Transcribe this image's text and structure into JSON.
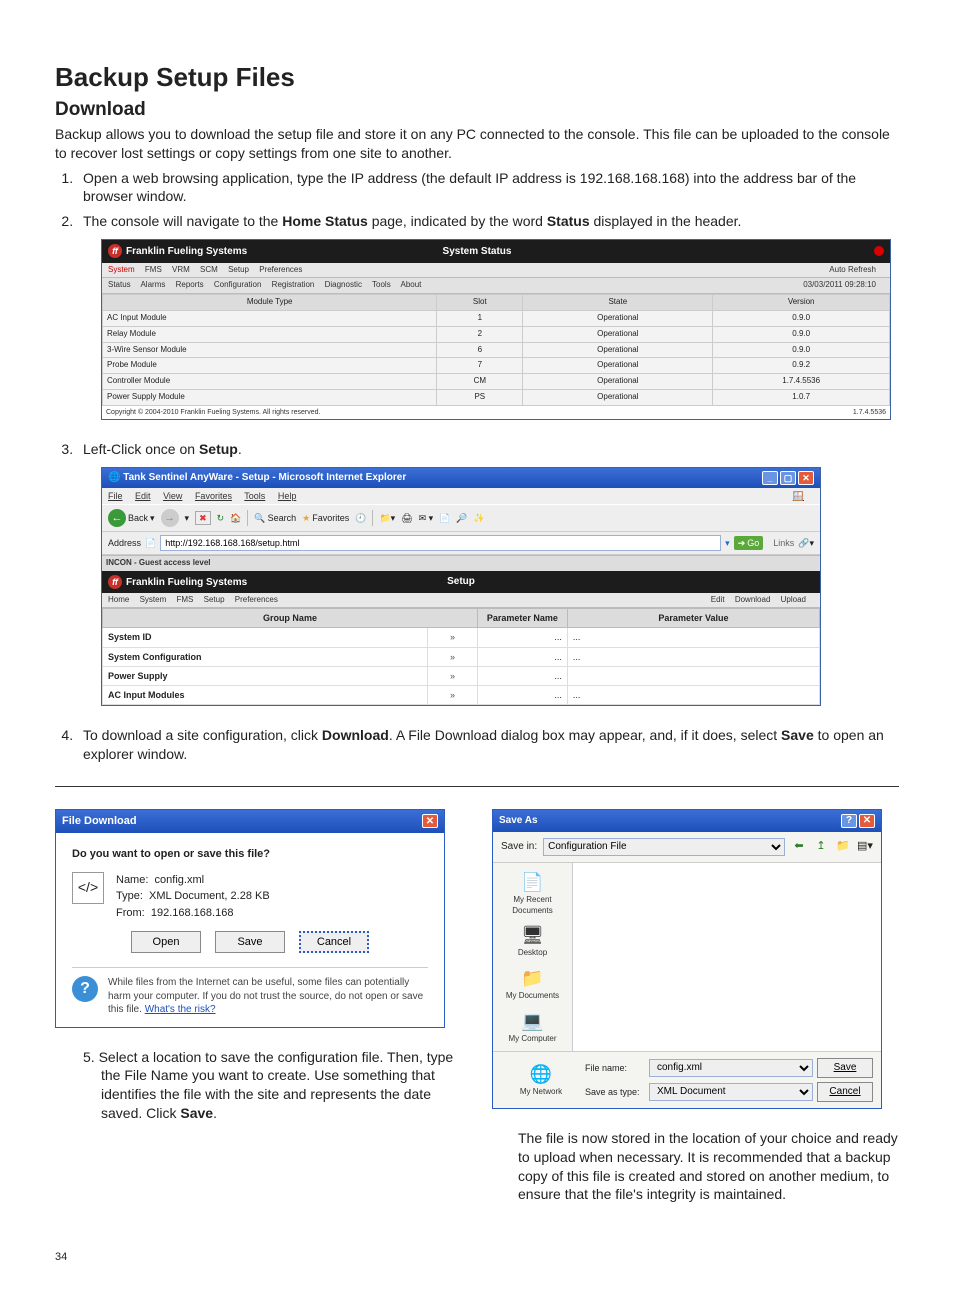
{
  "title": "Backup Setup Files",
  "sub": "Download",
  "intro": "Backup allows you to download the setup file and store it on any PC connected to the console. This file can be uploaded to the console to recover lost settings or copy settings from one site to another.",
  "step1a": "Open a web browsing application, type the IP address (the default IP address is 192.168.168.168) into the address bar of the browser window.",
  "step2a": "The console will navigate to the ",
  "step2b": "Home Status",
  "step2c": " page, indicated by the word ",
  "step2d": "Status",
  "step2e": " displayed in the header.",
  "step3a": "Left-Click once on ",
  "step3b": "Setup",
  "step3c": ".",
  "step4a": "To download a site configuration, click ",
  "step4b": "Download",
  "step4c": ". A File Download dialog box may appear, and, if it does, select ",
  "step4d": "Save",
  "step4e": " to open an explorer window.",
  "step5a": "5.   Select a location to save the configuration file. Then, type the File Name you want to create. Use something that identifies the file with the site and represents the date saved. Click ",
  "step5b": "Save",
  "step5c": ".",
  "finalNote": "The file is now stored in the location of your choice and ready to upload when necessary. It is recommended that a backup copy of this file is created and stored on another medium, to ensure that the file's integrity is maintained.",
  "fig1": {
    "brand": "Franklin Fueling Systems",
    "hdrCenter": "System Status",
    "autoRefresh": "Auto Refresh",
    "timestamp": "03/03/2011 09:28:10",
    "tabsL": [
      "System",
      "FMS",
      "VRM",
      "SCM",
      "Setup",
      "Preferences"
    ],
    "subtabs": [
      "Status",
      "Alarms",
      "Reports",
      "Configuration",
      "Registration",
      "Diagnostic",
      "Tools",
      "About"
    ],
    "cols": [
      "Module Type",
      "Slot",
      "State",
      "Version"
    ],
    "rows": [
      [
        "AC Input Module",
        "1",
        "Operational",
        "0.9.0"
      ],
      [
        "Relay Module",
        "2",
        "Operational",
        "0.9.0"
      ],
      [
        "3-Wire Sensor Module",
        "6",
        "Operational",
        "0.9.0"
      ],
      [
        "Probe Module",
        "7",
        "Operational",
        "0.9.2"
      ],
      [
        "Controller Module",
        "CM",
        "Operational",
        "1.7.4.5536"
      ],
      [
        "Power Supply Module",
        "PS",
        "Operational",
        "1.0.7"
      ]
    ],
    "copyright": "Copyright © 2004-2010 Franklin Fueling Systems. All rights reserved.",
    "ver": "1.7.4.5536"
  },
  "fig2": {
    "winTitle": "Tank Sentinel AnyWare - Setup - Microsoft Internet Explorer",
    "menus": [
      "File",
      "Edit",
      "View",
      "Favorites",
      "Tools",
      "Help"
    ],
    "back": "Back",
    "search": "Search",
    "favorites": "Favorites",
    "addrLabel": "Address",
    "addrVal": "http://192.168.168.168/setup.html",
    "go": "Go",
    "links": "Links",
    "access": "INCON - Guest access level",
    "brand": "Franklin Fueling Systems",
    "hdrCenter": "Setup",
    "tabsL": [
      "Home",
      "System",
      "FMS",
      "Setup",
      "Preferences"
    ],
    "tabsR": [
      "Edit",
      "Download",
      "Upload"
    ],
    "cols": [
      "Group Name",
      "",
      "Parameter Name",
      "Parameter Value"
    ],
    "rows": [
      [
        "System ID",
        "»",
        "...",
        "..."
      ],
      [
        "System Configuration",
        "»",
        "...",
        "..."
      ],
      [
        "Power Supply",
        "»",
        "...",
        ""
      ],
      [
        "AC Input Modules",
        "»",
        "...",
        "..."
      ]
    ]
  },
  "dlg": {
    "title": "File Download",
    "question": "Do you want to open or save this file?",
    "nameL": "Name:",
    "nameV": "config.xml",
    "typeL": "Type:",
    "typeV": "XML Document, 2.28 KB",
    "fromL": "From:",
    "fromV": "192.168.168.168",
    "open": "Open",
    "save": "Save",
    "cancel": "Cancel",
    "warn1": "While files from the Internet can be useful, some files can potentially harm your computer. If you do not trust the source, do not open or save this file. ",
    "warn2": "What's the risk?"
  },
  "save": {
    "title": "Save As",
    "savein": "Save in:",
    "folder": "Configuration File",
    "side": [
      "My Recent Documents",
      "Desktop",
      "My Documents",
      "My Computer",
      "My Network"
    ],
    "fnL": "File name:",
    "fnV": "config.xml",
    "stL": "Save as type:",
    "stV": "XML Document",
    "saveBtn": "Save",
    "cancelBtn": "Cancel"
  },
  "pageNum": "34"
}
